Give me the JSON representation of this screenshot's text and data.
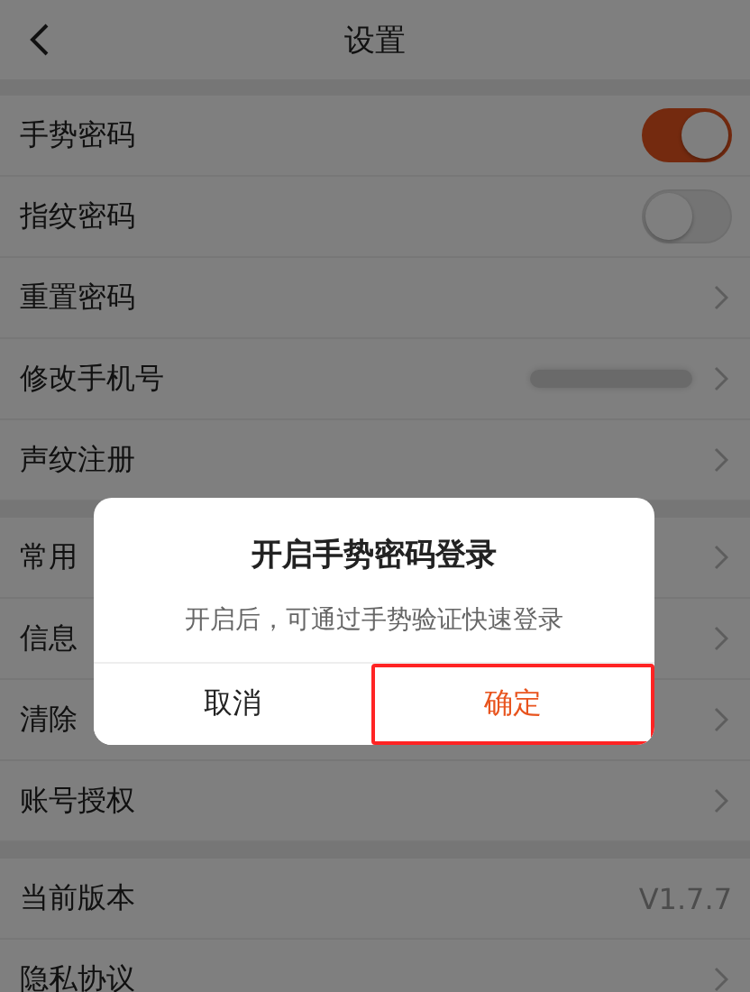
{
  "header": {
    "title": "设置"
  },
  "groups": [
    [
      {
        "label": "手势密码",
        "kind": "toggle",
        "on": true
      },
      {
        "label": "指纹密码",
        "kind": "toggle",
        "on": false
      },
      {
        "label": "重置密码",
        "kind": "link"
      },
      {
        "label": "修改手机号",
        "kind": "masked"
      },
      {
        "label": "声纹注册",
        "kind": "link"
      }
    ],
    [
      {
        "label": "常用",
        "kind": "link"
      },
      {
        "label": "信息",
        "kind": "link"
      },
      {
        "label": "清除",
        "kind": "link"
      },
      {
        "label": "账号授权",
        "kind": "link"
      }
    ],
    [
      {
        "label": "当前版本",
        "kind": "value",
        "value": "V1.7.7"
      },
      {
        "label": "隐私协议",
        "kind": "link"
      }
    ]
  ],
  "dialog": {
    "title": "开启手势密码登录",
    "message": "开启后，可通过手势验证快速登录",
    "buttons": [
      {
        "label": "取消",
        "primary": false,
        "highlighted": false
      },
      {
        "label": "确定",
        "primary": true,
        "highlighted": true
      }
    ]
  }
}
